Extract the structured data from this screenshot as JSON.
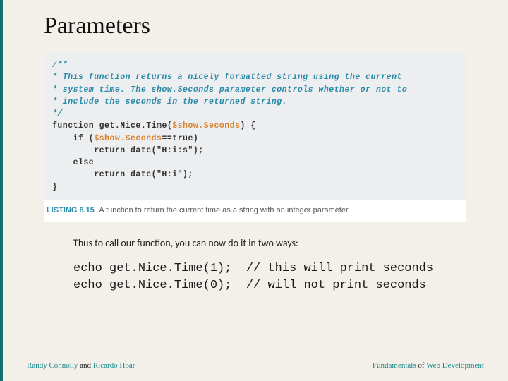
{
  "title": "Parameters",
  "code": {
    "doc1": "/**",
    "doc2": " * This function returns a nicely formatted string using the current",
    "doc3": " * system time. The show.Seconds parameter controls whether or not to",
    "doc4": " * include the seconds in the returned string.",
    "doc5": " */",
    "fn_kw": "function",
    "fn_name": "get.Nice.Time",
    "fn_open": "(",
    "fn_param": "$show.Seconds",
    "fn_close": ") {",
    "if_line_a": "    if (",
    "if_var": "$show.Seconds",
    "if_line_b": "==true)",
    "ret1": "        return date(\"H:i:s\");",
    "else_line": "    else",
    "ret2": "        return date(\"H:i\");",
    "close": "}"
  },
  "listing": {
    "label": "LISTING 8.15",
    "caption": "A function to return the current time as a string with an integer parameter"
  },
  "bodytext": "Thus to call our function, you can now do it in two ways:",
  "examples": {
    "line1": "echo get.Nice.Time(1);  // this will print seconds",
    "line2": "echo get.Nice.Time(0);  // will not print seconds"
  },
  "footer": {
    "a1": "Randy Connolly",
    "and": " and ",
    "a2": "Ricardo Hoar",
    "b1": "Fundamentals",
    "of": " of ",
    "b2": "Web Development"
  }
}
